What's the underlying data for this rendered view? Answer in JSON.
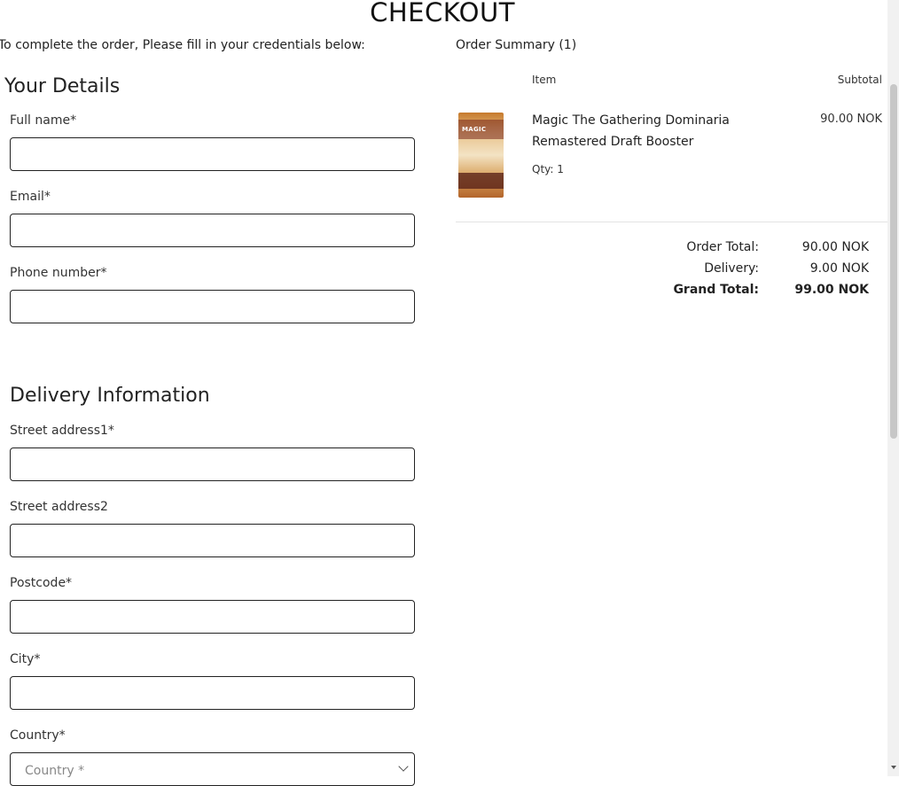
{
  "page": {
    "title": "CHECKOUT",
    "intro": "To complete the order, Please fill in your credentials below:"
  },
  "details": {
    "heading": "Your Details",
    "fields": {
      "full_name": {
        "label": "Full name*",
        "value": ""
      },
      "email": {
        "label": "Email*",
        "value": ""
      },
      "phone": {
        "label": "Phone number*",
        "value": ""
      }
    }
  },
  "delivery": {
    "heading": "Delivery Information",
    "fields": {
      "street1": {
        "label": "Street address1*",
        "value": ""
      },
      "street2": {
        "label": "Street address2",
        "value": ""
      },
      "postcode": {
        "label": "Postcode*",
        "value": ""
      },
      "city": {
        "label": "City*",
        "value": ""
      },
      "country": {
        "label": "Country*",
        "selected": "Country *"
      }
    }
  },
  "summary": {
    "title": "Order Summary (1)",
    "col_item": "Item",
    "col_subtotal": "Subtotal",
    "items": [
      {
        "name": "Magic The Gathering Dominaria Remastered Draft Booster",
        "qty": "Qty: 1",
        "subtotal": "90.00 NOK",
        "image_logo_text": "MAGIC"
      }
    ],
    "totals": {
      "order_total_label": "Order Total:",
      "order_total": "90.00 NOK",
      "delivery_label": "Delivery:",
      "delivery": "9.00 NOK",
      "grand_total_label": "Grand Total:",
      "grand_total": "99.00 NOK"
    }
  }
}
